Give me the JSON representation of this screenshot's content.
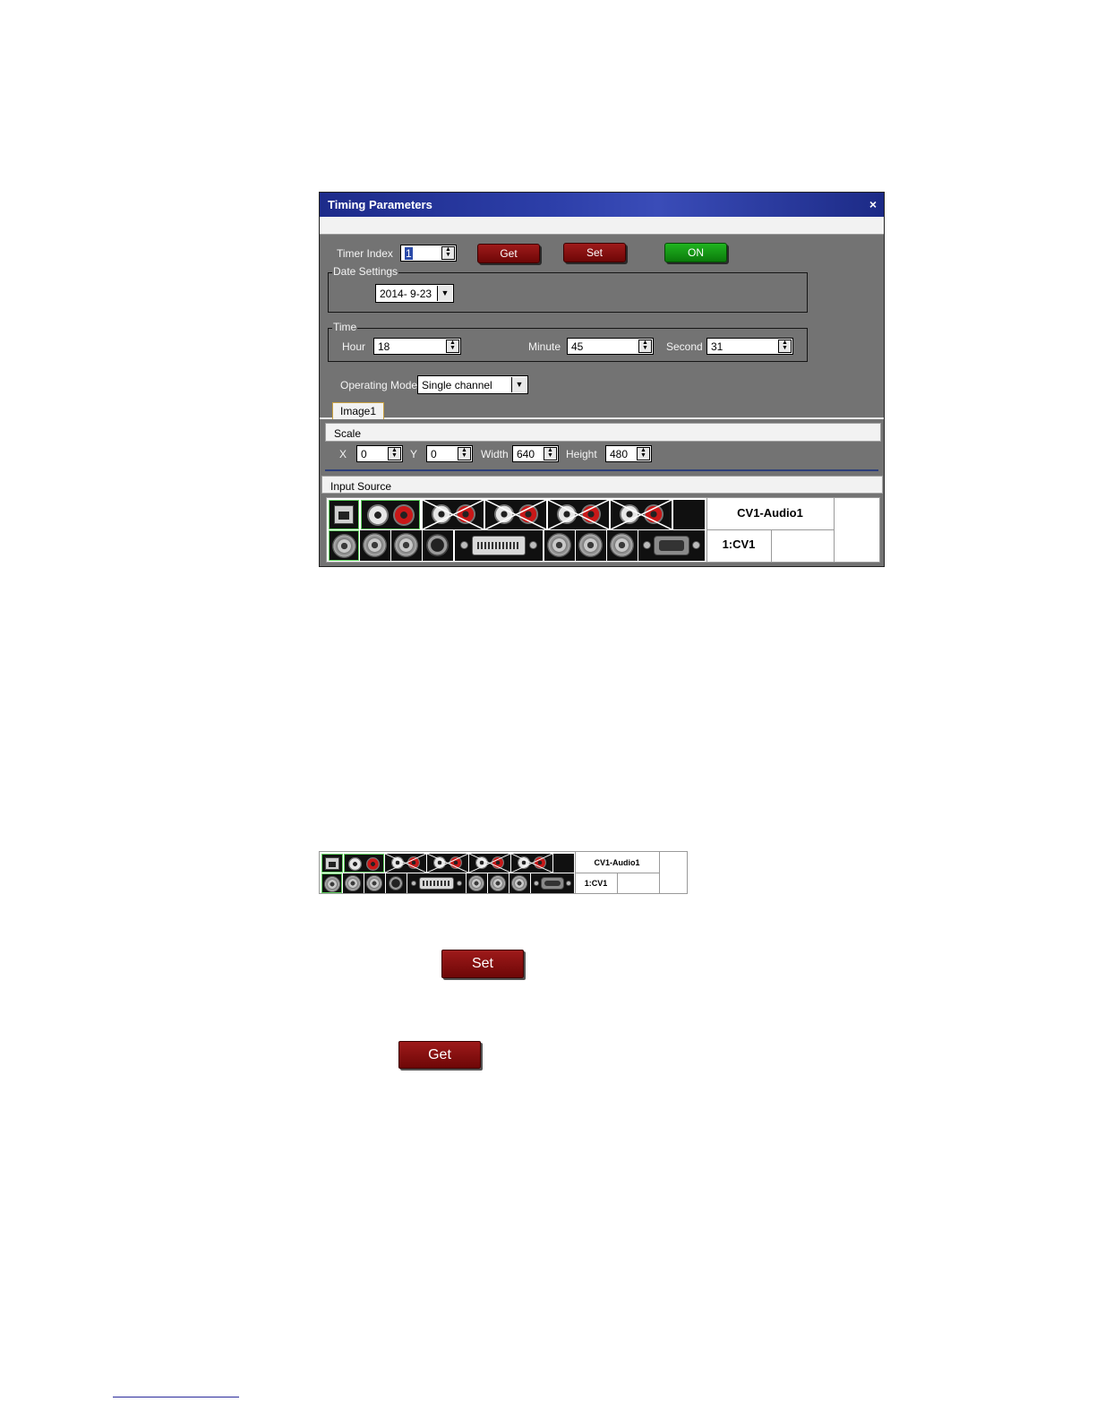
{
  "dialog": {
    "title": "Timing Parameters",
    "close_glyph": "×",
    "timer_index_label": "Timer Index",
    "timer_index_value": "1",
    "get_label": "Get",
    "set_label": "Set",
    "on_label": "ON",
    "date_group_label": "Date Settings",
    "date_value": "2014- 9-23",
    "time_group_label": "Time",
    "hour_label": "Hour",
    "hour_value": "18",
    "minute_label": "Minute",
    "minute_value": "45",
    "second_label": "Second",
    "second_value": "31",
    "operating_mode_label": "Operating Mode",
    "operating_mode_value": "Single channel",
    "tab_label": "Image1",
    "scale_label": "Scale",
    "x_label": "X",
    "x_value": "0",
    "y_label": "Y",
    "y_value": "0",
    "width_label": "Width",
    "width_value": "640",
    "height_label": "Height",
    "height_value": "480",
    "input_source_label": "Input Source"
  },
  "input_panel": {
    "audio_source": "CV1-Audio1",
    "video_source": "1:CV1"
  },
  "standalone": {
    "set_label": "Set",
    "get_label": "Get"
  },
  "colors": {
    "title_bar": "#2c3ea8",
    "dialog_bg": "#737373",
    "button_red": "#8a1010",
    "button_green": "#16a016",
    "highlight": "#5fd15f"
  },
  "icons": [
    "close-icon",
    "spin-arrows-icon",
    "dropdown-arrow-icon",
    "rj45-icon",
    "rca-jack-icon",
    "bnc-jack-icon",
    "s-video-icon",
    "dvi-port-icon",
    "vga-port-icon"
  ]
}
